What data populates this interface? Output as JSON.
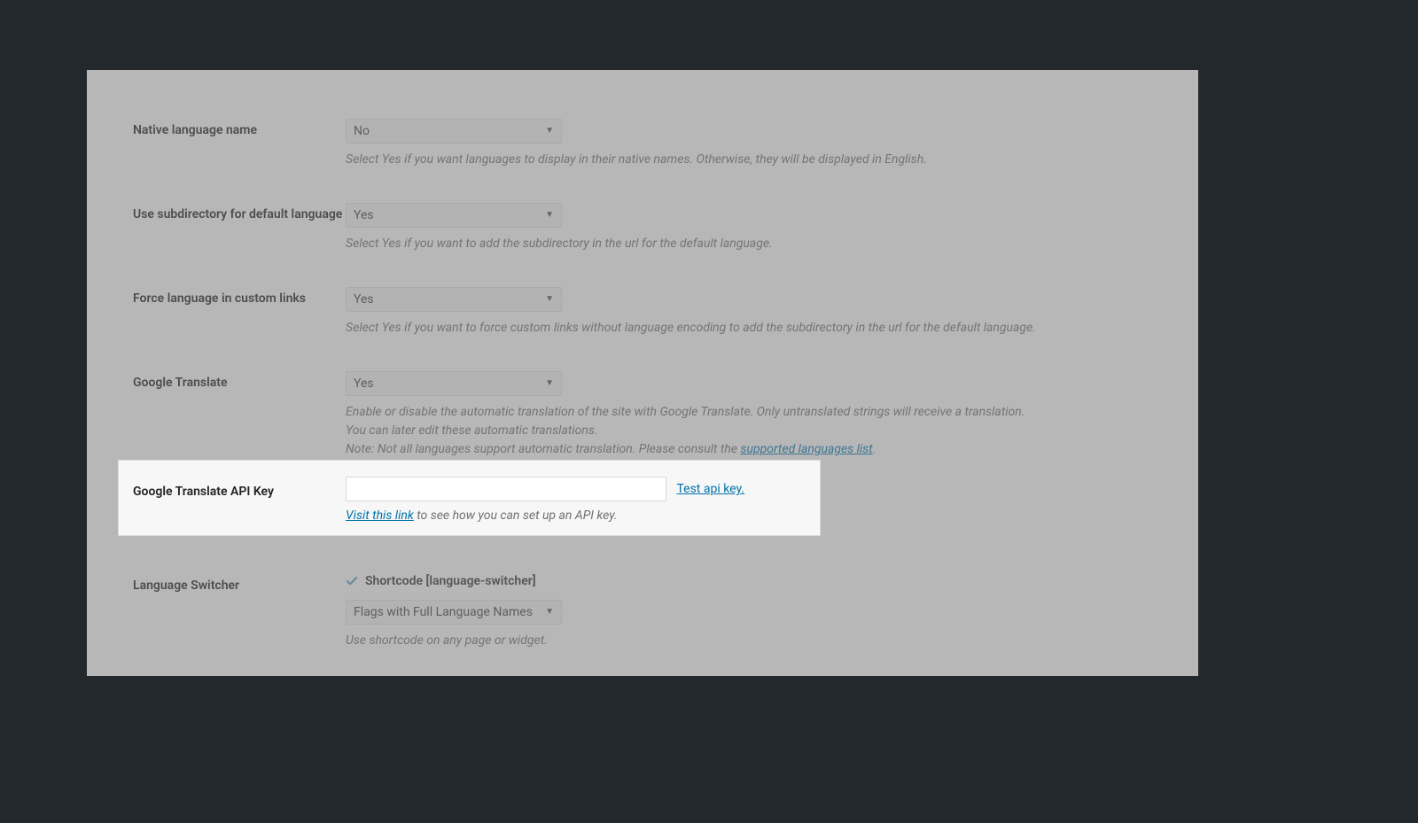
{
  "labels": {
    "native_language": "Native language name",
    "use_subdir": "Use subdirectory for default language",
    "force_custom": "Force language in custom links",
    "google_translate": "Google Translate",
    "api_key": "Google Translate API Key",
    "language_switcher": "Language Switcher"
  },
  "selects": {
    "native_language": "No",
    "use_subdir": "Yes",
    "force_custom": "Yes",
    "google_translate": "Yes",
    "switcher_style": "Flags with Full Language Names"
  },
  "desc": {
    "native_language": "Select Yes if you want languages to display in their native names. Otherwise, they will be displayed in English.",
    "use_subdir": "Select Yes if you want to add the subdirectory in the url for the default language.",
    "force_custom": "Select Yes if you want to force custom links without language encoding to add the subdirectory in the url for the default language.",
    "gt_line1": "Enable or disable the automatic translation of the site with Google Translate. Only untranslated strings will receive a translation.",
    "gt_line2": "You can later edit these automatic translations.",
    "gt_line3_pre": "Note: Not all languages support automatic translation. Please consult the ",
    "gt_line3_link": "supported languages list",
    "gt_line3_post": ".",
    "api_visit_link": "Visit this link",
    "api_visit_rest": " to see how you can set up an API key.",
    "switcher": "Use shortcode on any page or widget."
  },
  "api": {
    "value": "",
    "test_link": "Test api key."
  },
  "switcher": {
    "shortcode_label": "Shortcode [language-switcher]"
  }
}
